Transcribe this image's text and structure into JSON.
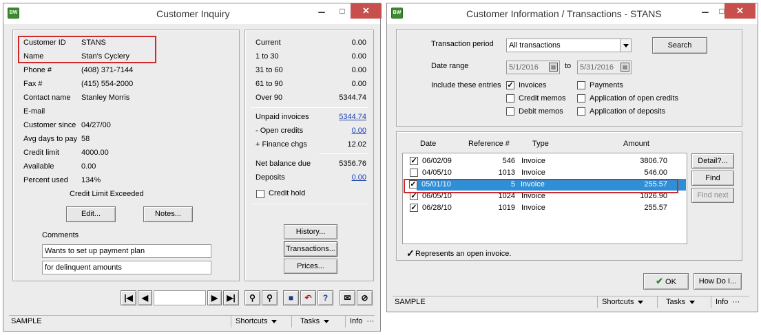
{
  "left": {
    "title": "Customer Inquiry",
    "app_icon": "BW",
    "customer": {
      "id_label": "Customer ID",
      "id_value": "STANS",
      "name_label": "Name",
      "name_value": "Stan's Cyclery",
      "phone_label": "Phone #",
      "phone_value": "(408) 371-7144",
      "fax_label": "Fax #",
      "fax_value": "(415) 554-2000",
      "contact_label": "Contact name",
      "contact_value": "Stanley Morris",
      "email_label": "E-mail",
      "email_value": "",
      "since_label": "Customer since",
      "since_value": "04/27/00",
      "avgdays_label": "Avg days to pay",
      "avgdays_value": "58",
      "limit_label": "Credit limit",
      "limit_value": "4000.00",
      "available_label": "Available",
      "available_value": "0.00",
      "percent_label": "Percent used",
      "percent_value": "134%",
      "exceeded": "Credit Limit Exceeded"
    },
    "edit_button": "Edit...",
    "notes_button": "Notes...",
    "comments_label": "Comments",
    "comment1": "Wants to set up payment plan",
    "comment2": "for delinquent amounts",
    "aging": {
      "current_label": "Current",
      "current_value": "0.00",
      "d1_30_label": "1 to 30",
      "d1_30_value": "0.00",
      "d31_60_label": "31 to 60",
      "d31_60_value": "0.00",
      "d61_90_label": "61 to 90",
      "d61_90_value": "0.00",
      "over90_label": "Over 90",
      "over90_value": "5344.74",
      "unpaid_label": "Unpaid invoices",
      "unpaid_value": "5344.74",
      "open_credits_label": "- Open credits",
      "open_credits_value": "0.00",
      "finance_label": "+ Finance chgs",
      "finance_value": "12.02",
      "net_label": "Net balance due",
      "net_value": "5356.76",
      "deposits_label": "Deposits",
      "deposits_value": "0.00",
      "credit_hold_label": "Credit hold"
    },
    "history_button": "History...",
    "transactions_button": "Transactions...",
    "prices_button": "Prices...",
    "status": {
      "text": "SAMPLE",
      "shortcuts": "Shortcuts",
      "tasks": "Tasks",
      "info": "Info"
    }
  },
  "right": {
    "title": "Customer Information / Transactions - STANS",
    "app_icon": "BW",
    "period_label": "Transaction period",
    "period_value": "All transactions",
    "search_button": "Search",
    "date_range_label": "Date range",
    "date_from": "5/1/2016",
    "date_to_label": "to",
    "date_to": "5/31/2016",
    "include_label": "Include these entries",
    "entries": [
      {
        "label": "Invoices",
        "checked": true
      },
      {
        "label": "Credit memos",
        "checked": false
      },
      {
        "label": "Debit memos",
        "checked": false
      },
      {
        "label": "Payments",
        "checked": false
      },
      {
        "label": "Application of open credits",
        "checked": false
      },
      {
        "label": "Application of deposits",
        "checked": false
      }
    ],
    "columns": [
      "Date",
      "Reference #",
      "Type",
      "Amount"
    ],
    "rows": [
      {
        "check": "checked",
        "date": "06/02/09",
        "ref": "546",
        "type": "Invoice",
        "amount": "3806.70"
      },
      {
        "check": "unchecked",
        "date": "04/05/10",
        "ref": "1013",
        "type": "Invoice",
        "amount": "546.00"
      },
      {
        "check": "checked",
        "date": "05/01/10",
        "ref": "5",
        "type": "Invoice",
        "amount": "255.57"
      },
      {
        "check": "checked",
        "date": "06/05/10",
        "ref": "1024",
        "type": "Invoice",
        "amount": "1026.90"
      },
      {
        "check": "checked",
        "date": "06/28/10",
        "ref": "1019",
        "type": "Invoice",
        "amount": "255.57"
      }
    ],
    "detail_button": "Detail?...",
    "find_button": "Find",
    "find_next_button": "Find next",
    "legend": "Represents an open invoice.",
    "ok_button": "OK",
    "howdoi_button": "How Do I...",
    "status": {
      "text": "SAMPLE",
      "shortcuts": "Shortcuts",
      "tasks": "Tasks",
      "info": "Info"
    }
  },
  "colors": {
    "highlight": "#d0282b",
    "selection": "#2f8fd6",
    "link": "#1a3fb0",
    "close": "#c7504d"
  }
}
